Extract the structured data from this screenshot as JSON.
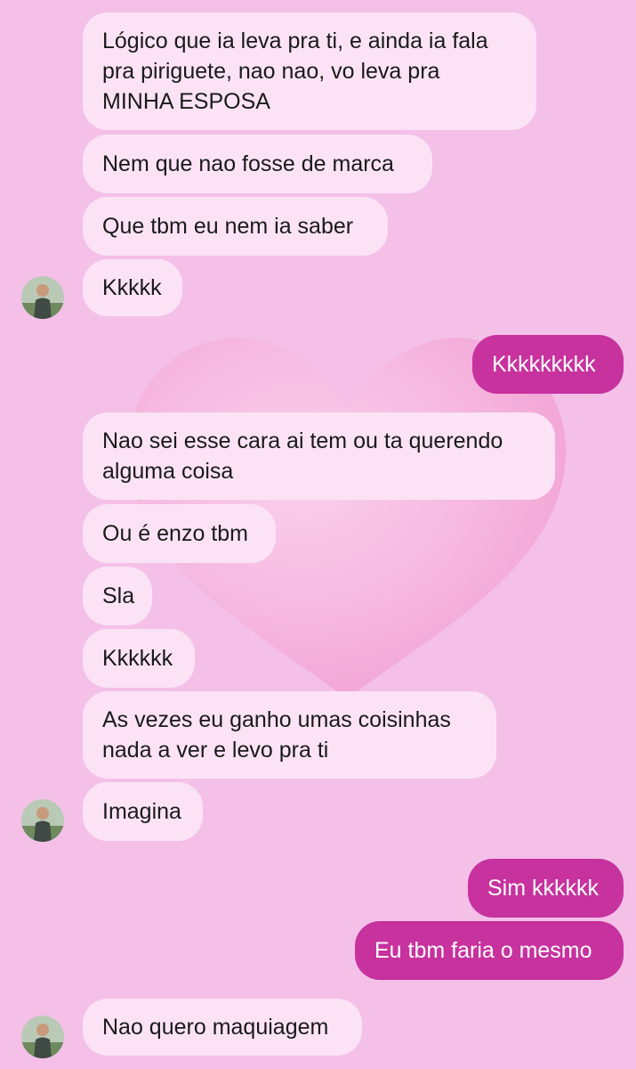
{
  "conversation": {
    "messages": [
      {
        "sender": "contact",
        "text": "Lógico que ia leva pra ti, e ainda ia fala\npra piriguete, nao nao, vo leva pra\nMINHA ESPOSA"
      },
      {
        "sender": "contact",
        "text": "Nem que nao fosse de marca"
      },
      {
        "sender": "contact",
        "text": "Que tbm eu nem ia saber"
      },
      {
        "sender": "contact",
        "text": "Kkkkk"
      },
      {
        "sender": "me",
        "text": "Kkkkkkkkk"
      },
      {
        "sender": "contact",
        "text": "Nao sei esse cara ai tem ou ta querendo\nalguma coisa"
      },
      {
        "sender": "contact",
        "text": "Ou é enzo tbm"
      },
      {
        "sender": "contact",
        "text": "Sla"
      },
      {
        "sender": "contact",
        "text": "Kkkkkk"
      },
      {
        "sender": "contact",
        "text": "As vezes eu ganho umas coisinhas\nnada a ver e levo pra ti"
      },
      {
        "sender": "contact",
        "text": "Imagina"
      },
      {
        "sender": "me",
        "text": "Sim kkkkkk"
      },
      {
        "sender": "me",
        "text": "Eu tbm faria o mesmo"
      },
      {
        "sender": "contact",
        "text": "Nao quero maquiagem"
      }
    ]
  },
  "contact_avatar_icon": "profile-photo-icon",
  "colors": {
    "background": "#f4c0e8",
    "incoming_bubble": "#fbe3f5",
    "outgoing_bubble": "#c7329e",
    "incoming_text": "#1a1a1a",
    "outgoing_text": "#ffffff"
  }
}
